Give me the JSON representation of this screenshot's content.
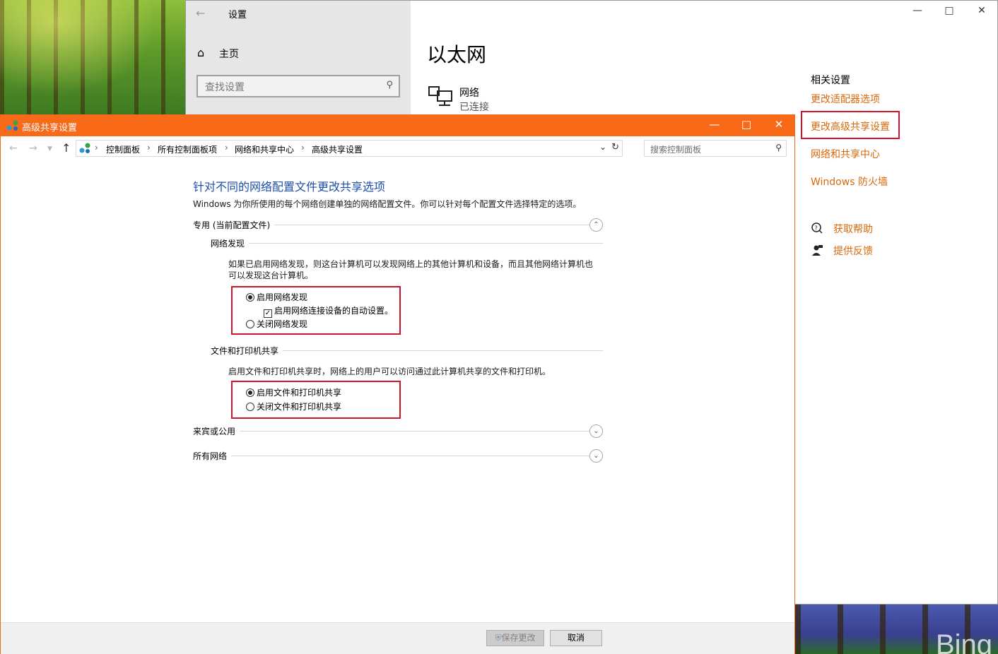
{
  "settings": {
    "title": "设置",
    "home": "主页",
    "search_placeholder": "查找设置",
    "page_title": "以太网",
    "network": {
      "name": "网络",
      "status": "已连接"
    },
    "related_title": "相关设置",
    "related_links": [
      "更改适配器选项",
      "更改高级共享设置",
      "网络和共享中心",
      "Windows 防火墙"
    ],
    "help": "获取帮助",
    "feedback": "提供反馈"
  },
  "advanced": {
    "title": "高级共享设置",
    "breadcrumbs": [
      "控制面板",
      "所有控制面板项",
      "网络和共享中心",
      "高级共享设置"
    ],
    "search_placeholder": "搜索控制面板",
    "heading": "针对不同的网络配置文件更改共享选项",
    "description": "Windows 为你所使用的每个网络创建单独的网络配置文件。你可以针对每个配置文件选择特定的选项。",
    "profile_private": "专用 (当前配置文件)",
    "discovery": {
      "title": "网络发现",
      "text": "如果已启用网络发现，则这台计算机可以发现网络上的其他计算机和设备，而且其他网络计算机也可以发现这台计算机。",
      "on": "启用网络发现",
      "auto": "启用网络连接设备的自动设置。",
      "off": "关闭网络发现"
    },
    "sharing": {
      "title": "文件和打印机共享",
      "text": "启用文件和打印机共享时，网络上的用户可以访问通过此计算机共享的文件和打印机。",
      "on": "启用文件和打印机共享",
      "off": "关闭文件和打印机共享"
    },
    "profile_guest": "来宾或公用",
    "profile_all": "所有网络",
    "save": "保存更改",
    "cancel": "取消"
  },
  "wallpaper_text": "Bing",
  "colors": {
    "accent": "#f86a18",
    "link": "#d8690a",
    "heading": "#1e4ea8",
    "highlight": "#d0152a"
  }
}
